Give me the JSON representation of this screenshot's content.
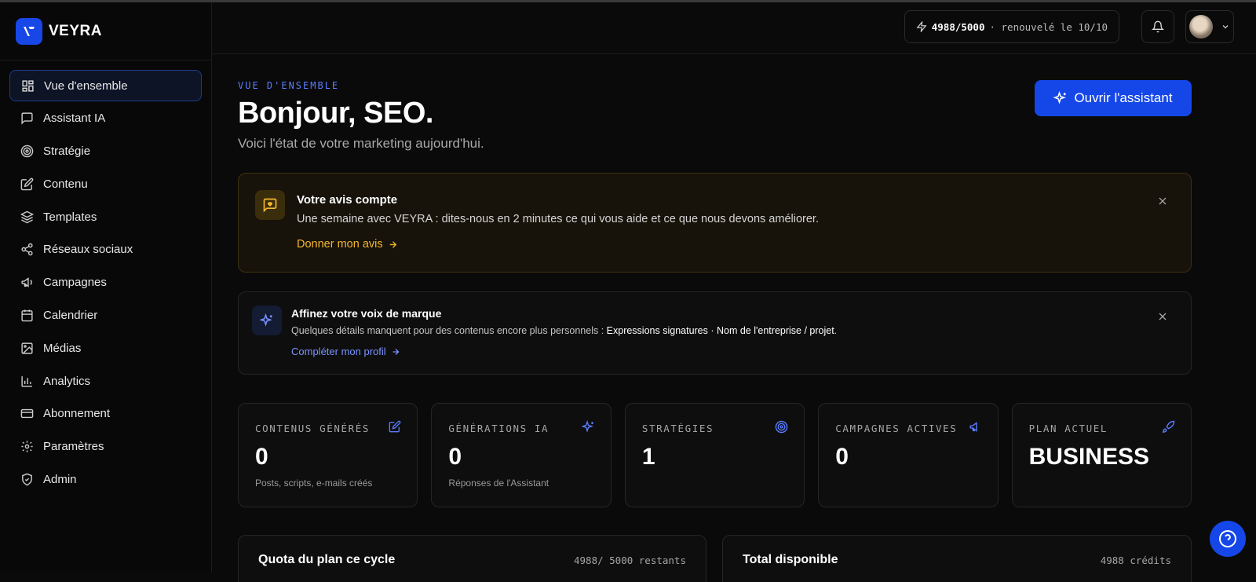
{
  "brand": {
    "name": "VEYRA",
    "accent": "#1547e8"
  },
  "sidebar": {
    "items": [
      {
        "label": "Vue d'ensemble",
        "icon": "grid-icon",
        "active": true
      },
      {
        "label": "Assistant IA",
        "icon": "chat-icon"
      },
      {
        "label": "Stratégie",
        "icon": "target-icon"
      },
      {
        "label": "Contenu",
        "icon": "edit-icon"
      },
      {
        "label": "Templates",
        "icon": "layers-icon"
      },
      {
        "label": "Réseaux sociaux",
        "icon": "share-icon"
      },
      {
        "label": "Campagnes",
        "icon": "megaphone-icon"
      },
      {
        "label": "Calendrier",
        "icon": "calendar-icon"
      },
      {
        "label": "Médias",
        "icon": "image-icon"
      },
      {
        "label": "Analytics",
        "icon": "bar-chart-icon"
      },
      {
        "label": "Abonnement",
        "icon": "credit-card-icon"
      },
      {
        "label": "Paramètres",
        "icon": "gear-icon"
      },
      {
        "label": "Admin",
        "icon": "shield-icon"
      }
    ]
  },
  "header": {
    "credits_value": "4988/5000",
    "credits_renewal": "· renouvelé le 10/10"
  },
  "page": {
    "eyebrow": "VUE D'ENSEMBLE",
    "title": "Bonjour, SEO.",
    "subtitle": "Voici l'état de votre marketing aujourd'hui.",
    "assistant_button": "Ouvrir l'assistant"
  },
  "feedback_banner": {
    "title": "Votre avis compte",
    "text": "Une semaine avec VEYRA : dites-nous en 2 minutes ce qui vous aide et ce que nous devons améliorer.",
    "link": "Donner mon avis",
    "accent": "#f5b72e"
  },
  "brand_voice_banner": {
    "title": "Affinez votre voix de marque",
    "text_prefix": "Quelques détails manquent pour des contenus encore plus personnels : ",
    "missing": "Expressions signatures · Nom de l'entreprise / projet",
    "text_suffix": ".",
    "link": "Compléter mon profil",
    "accent": "#7b93ff"
  },
  "stats": [
    {
      "label": "CONTENUS GÉNÉRÉS",
      "value": "0",
      "sub": "Posts, scripts, e-mails créés",
      "icon": "edit-icon"
    },
    {
      "label": "GÉNÉRATIONS IA",
      "value": "0",
      "sub": "Réponses de l'Assistant",
      "icon": "sparkle-icon"
    },
    {
      "label": "STRATÉGIES",
      "value": "1",
      "sub": "",
      "icon": "target-icon"
    },
    {
      "label": "CAMPAGNES ACTIVES",
      "value": "0",
      "sub": "",
      "icon": "megaphone-icon"
    },
    {
      "label": "PLAN ACTUEL",
      "value": "BUSINESS",
      "sub": "",
      "icon": "rocket-icon"
    }
  ],
  "quota_card": {
    "title": "Quota du plan ce cycle",
    "right": "4988/ 5000 restants"
  },
  "total_card": {
    "title": "Total disponible",
    "right": "4988 crédits"
  }
}
